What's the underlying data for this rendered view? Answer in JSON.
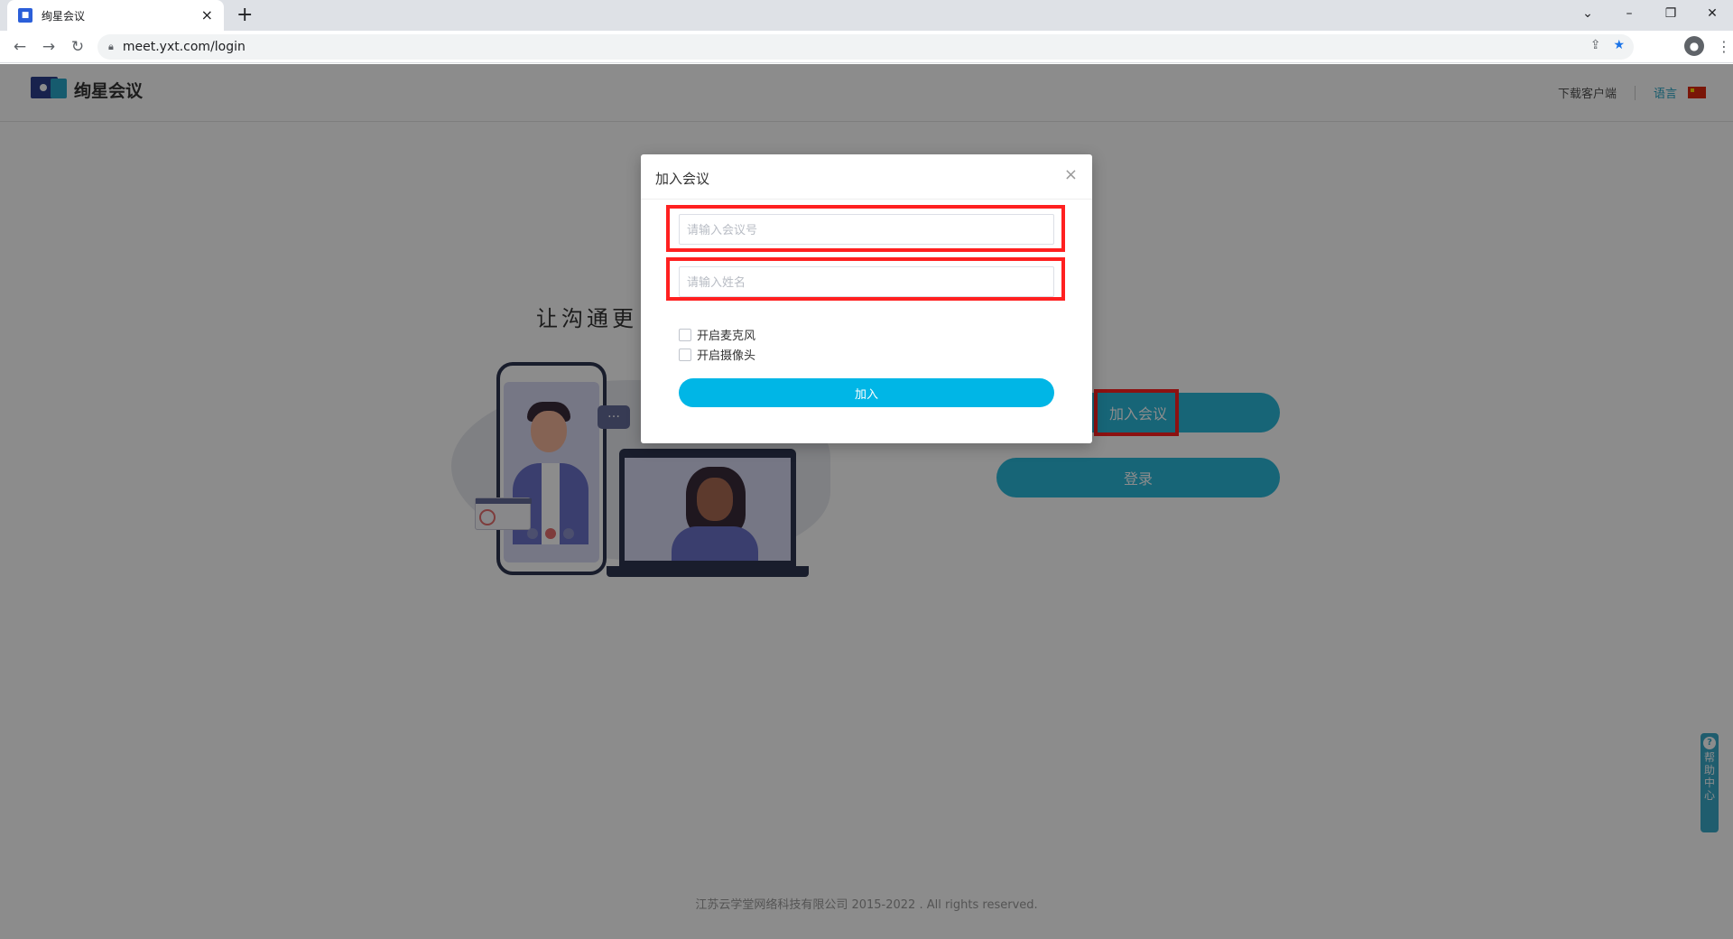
{
  "browser": {
    "tab_title": "绚星会议",
    "favicon": "meeting-favicon",
    "new_tab_symbol": "+",
    "tab_close_symbol": "×",
    "url": "meet.yxt.com/login",
    "window_controls": [
      "⌄",
      "–",
      "❐",
      "✕"
    ]
  },
  "header": {
    "logo_text": "绚星会议",
    "download_link": "下载客户端",
    "language_label": "语言",
    "accent_color": "#2aa7c5"
  },
  "hero": {
    "slogan": "让沟通更"
  },
  "actions": {
    "join_label": "加入会议",
    "login_label": "登录",
    "button_color": "#2ab8d9"
  },
  "help": {
    "question_mark": "?",
    "chars": [
      "帮",
      "助",
      "中",
      "心"
    ]
  },
  "footer": {
    "copyright": "江苏云学堂网络科技有限公司 2015-2022 . All rights reserved."
  },
  "dialog": {
    "title": "加入会议",
    "close_symbol": "×",
    "meeting_number_placeholder": "请输入会议号",
    "meeting_number_value": "",
    "name_placeholder": "请输入姓名",
    "name_value": "",
    "mic_label": "开启麦克风",
    "mic_checked": false,
    "camera_label": "开启摄像头",
    "camera_checked": false,
    "join_button": "加入",
    "join_button_color": "#00b6e6"
  },
  "annotations": {
    "highlight_color": "#ff2020"
  }
}
